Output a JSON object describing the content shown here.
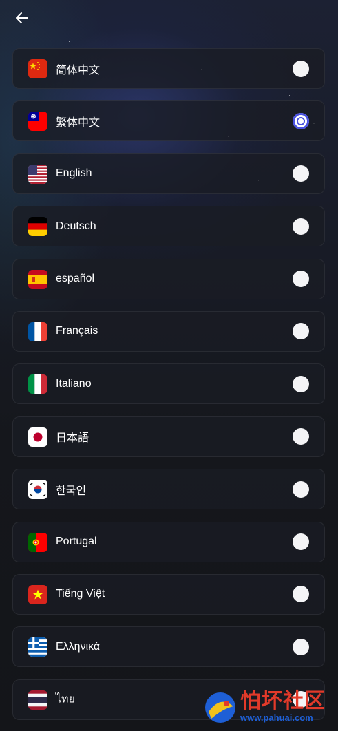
{
  "header": {
    "back_icon": "arrow-left-icon"
  },
  "languages": [
    {
      "label": "简体中文",
      "flag": "china-flag-icon",
      "selected": false
    },
    {
      "label": "繁体中文",
      "flag": "taiwan-flag-icon",
      "selected": true
    },
    {
      "label": "English",
      "flag": "usa-flag-icon",
      "selected": false
    },
    {
      "label": "Deutsch",
      "flag": "germany-flag-icon",
      "selected": false
    },
    {
      "label": "español",
      "flag": "spain-flag-icon",
      "selected": false
    },
    {
      "label": "Français",
      "flag": "france-flag-icon",
      "selected": false
    },
    {
      "label": "Italiano",
      "flag": "italy-flag-icon",
      "selected": false
    },
    {
      "label": "日本語",
      "flag": "japan-flag-icon",
      "selected": false
    },
    {
      "label": "한국인",
      "flag": "korea-flag-icon",
      "selected": false
    },
    {
      "label": "Portugal",
      "flag": "portugal-flag-icon",
      "selected": false
    },
    {
      "label": "Tiếng Việt",
      "flag": "vietnam-flag-icon",
      "selected": false
    },
    {
      "label": "Ελληνικά",
      "flag": "greece-flag-icon",
      "selected": false
    },
    {
      "label": "ไทย",
      "flag": "thailand-flag-icon",
      "selected": false
    }
  ],
  "colors": {
    "accent": "#4a52e0",
    "card_bg": "#1a1c24",
    "page_bg": "#15171c",
    "text": "#ffffff"
  },
  "watermark": {
    "title": "怕坏社区",
    "url": "www.pahuai.com"
  }
}
